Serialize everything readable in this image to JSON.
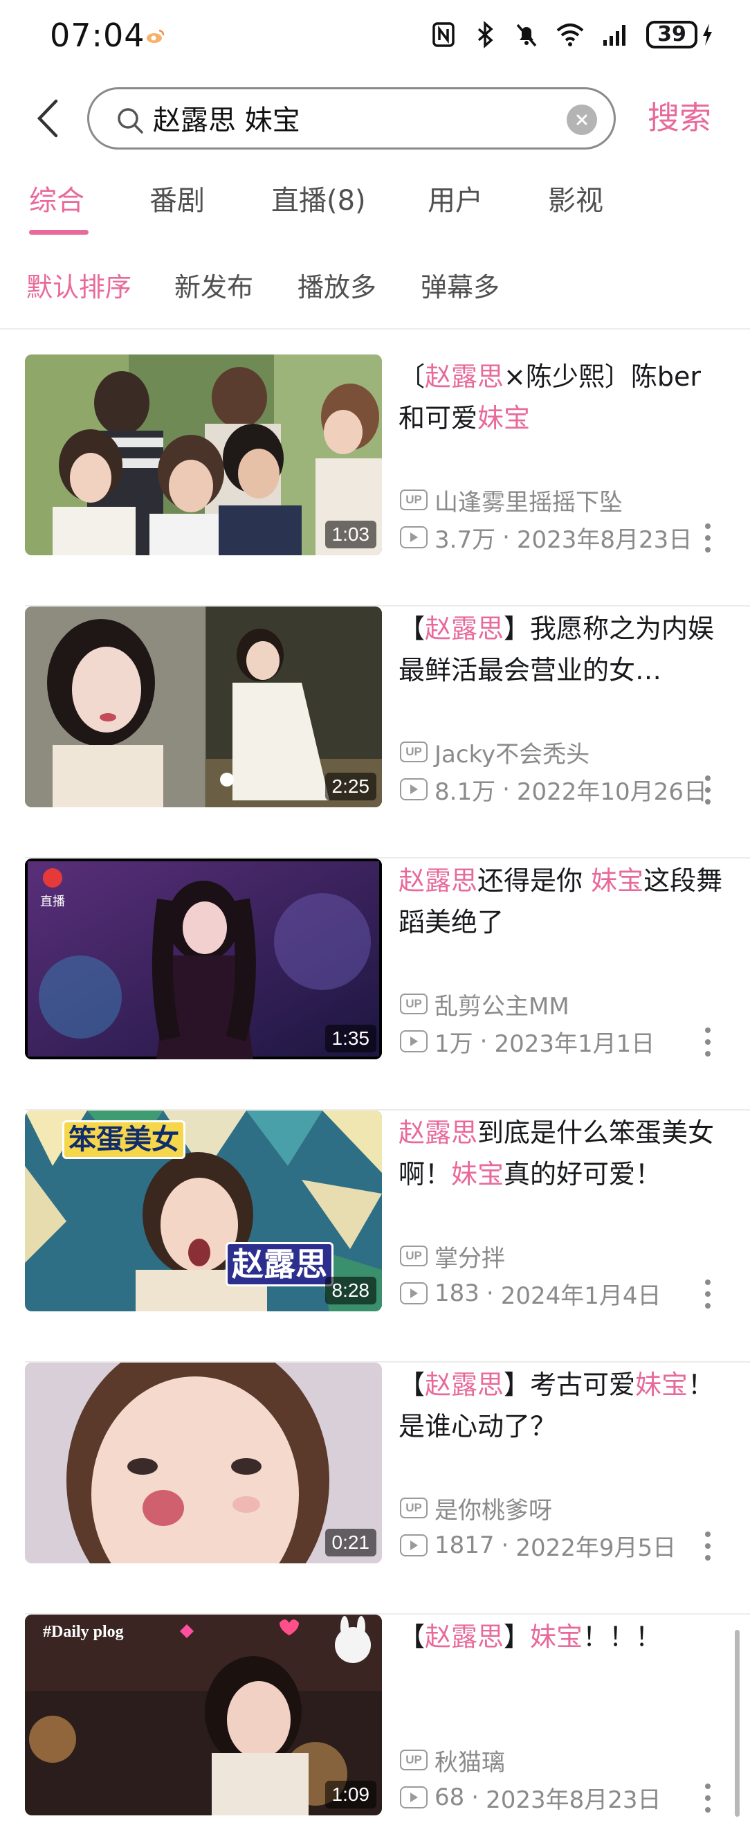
{
  "status_bar": {
    "time": "07:04",
    "battery": "39",
    "icons": [
      "weibo-icon",
      "nfc-icon",
      "bluetooth-icon",
      "mute-bell-icon",
      "wifi-icon",
      "signal-icon",
      "battery-icon",
      "charging-icon"
    ]
  },
  "search": {
    "query": "赵露思 妹宝",
    "button_label": "搜索"
  },
  "tabs": [
    "综合",
    "番剧",
    "直播(8)",
    "用户",
    "影视"
  ],
  "active_tab": "综合",
  "sort_options": [
    "默认排序",
    "新发布",
    "播放多",
    "弹幕多"
  ],
  "active_sort": "默认排序",
  "colors": {
    "accent": "#e86a9a",
    "text_primary": "#18191c",
    "text_secondary": "#8a8a8a"
  },
  "results": [
    {
      "title_parts": [
        {
          "t": "〔",
          "hl": false
        },
        {
          "t": "赵露思",
          "hl": true
        },
        {
          "t": "×陈少熙〕陈ber和可爱",
          "hl": false
        },
        {
          "t": "妹宝",
          "hl": true
        }
      ],
      "uploader": "山逢雾里摇摇下坠",
      "views": "3.7万",
      "date": "2023年8月23日",
      "duration": "1:03"
    },
    {
      "title_parts": [
        {
          "t": "【",
          "hl": false
        },
        {
          "t": "赵露思",
          "hl": true
        },
        {
          "t": "】我愿称之为内娱最鲜活最会营业的女…",
          "hl": false
        }
      ],
      "uploader": "Jacky不会秃头",
      "views": "8.1万",
      "date": "2022年10月26日",
      "duration": "2:25"
    },
    {
      "title_parts": [
        {
          "t": "赵露思",
          "hl": true
        },
        {
          "t": "还得是你 ",
          "hl": false
        },
        {
          "t": "妹宝",
          "hl": true
        },
        {
          "t": "这段舞蹈美绝了",
          "hl": false
        }
      ],
      "uploader": "乱剪公主MM",
      "views": "1万",
      "date": "2023年1月1日",
      "duration": "1:35"
    },
    {
      "title_parts": [
        {
          "t": "赵露思",
          "hl": true
        },
        {
          "t": "到底是什么笨蛋美女啊！",
          "hl": false
        },
        {
          "t": "妹宝",
          "hl": true
        },
        {
          "t": "真的好可爱！",
          "hl": false
        }
      ],
      "uploader": "掌分拌",
      "views": "183",
      "date": "2024年1月4日",
      "duration": "8:28",
      "thumb_text": [
        "笨蛋美女",
        "赵露思"
      ]
    },
    {
      "title_parts": [
        {
          "t": "【",
          "hl": false
        },
        {
          "t": "赵露思",
          "hl": true
        },
        {
          "t": "】考古可爱",
          "hl": false
        },
        {
          "t": "妹宝",
          "hl": true
        },
        {
          "t": "！是谁心动了？",
          "hl": false
        }
      ],
      "uploader": "是你桃爹呀",
      "views": "1817",
      "date": "2022年9月5日",
      "duration": "0:21"
    },
    {
      "title_parts": [
        {
          "t": "【",
          "hl": false
        },
        {
          "t": "赵露思",
          "hl": true
        },
        {
          "t": "】",
          "hl": false
        },
        {
          "t": "妹宝",
          "hl": true
        },
        {
          "t": "！！！",
          "hl": false
        }
      ],
      "uploader": "秋猫璃",
      "views": "68",
      "date": "2023年8月23日",
      "duration": "1:09",
      "thumb_text": [
        "#Daily plog"
      ]
    }
  ],
  "labels": {
    "up_badge": "UP",
    "meta_separator": " · ",
    "live_logo_text": "直播"
  }
}
